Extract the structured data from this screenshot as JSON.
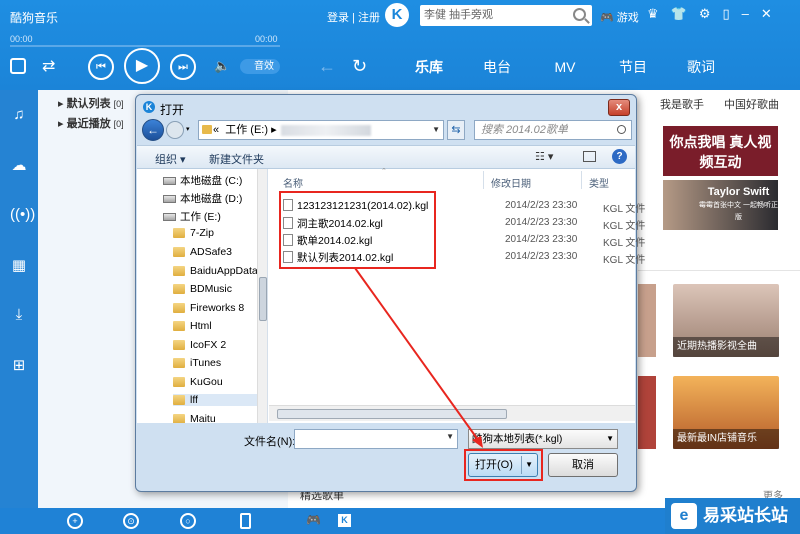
{
  "app": {
    "title": "酷狗音乐",
    "login": "登录 | 注册",
    "logo_letter": "K",
    "search_text": "李健  抽手旁观",
    "game": "游戏",
    "time_start": "00:00",
    "time_end": "00:00",
    "sound_effect": "音效",
    "tabs": [
      "乐库",
      "电台",
      "MV",
      "节目",
      "歌词"
    ],
    "playlists": [
      {
        "label": "默认列表",
        "count": "[0]"
      },
      {
        "label": "最近播放",
        "count": "[0]"
      }
    ],
    "right_links": [
      "我是歌手",
      "中国好歌曲"
    ],
    "banner_1": "你点我唱 真人视频互动",
    "banner_2": "Taylor Swift",
    "banner_2_sub": "霉霉首张中文 一起畅听正版",
    "thumb_1_caption": "近期热播影视全曲",
    "thumb_2_caption": "最新最IN店铺音乐",
    "more": "更多",
    "bottom_text": "精选歌单",
    "watermark": "易采站长站"
  },
  "dialog": {
    "title": "打开",
    "close": "x",
    "address": "工作 (E:)",
    "address_prefix": "«",
    "search_placeholder": "搜索 2014.02歌单",
    "organize": "组织 ▾",
    "new_folder": "新建文件夹",
    "tree": [
      {
        "label": "本地磁盘 (C:)",
        "kind": "drive"
      },
      {
        "label": "本地磁盘 (D:)",
        "kind": "drive"
      },
      {
        "label": "工作 (E:)",
        "kind": "drive"
      },
      {
        "label": "7-Zip",
        "kind": "folder"
      },
      {
        "label": "ADSafe3",
        "kind": "folder"
      },
      {
        "label": "BaiduAppData",
        "kind": "folder"
      },
      {
        "label": "BDMusic",
        "kind": "folder"
      },
      {
        "label": "Fireworks 8",
        "kind": "folder"
      },
      {
        "label": "Html",
        "kind": "folder"
      },
      {
        "label": "IcoFX 2",
        "kind": "folder"
      },
      {
        "label": "iTunes",
        "kind": "folder"
      },
      {
        "label": "KuGou",
        "kind": "folder"
      },
      {
        "label": "lff",
        "kind": "folder"
      },
      {
        "label": "Maitu",
        "kind": "folder"
      }
    ],
    "columns": {
      "name": "名称",
      "modified": "修改日期",
      "type": "类型"
    },
    "files": [
      {
        "name": "123123121231(2014.02).kgl",
        "date": "2014/2/23 23:30",
        "type": "KGL 文件"
      },
      {
        "name": "洞主歌2014.02.kgl",
        "date": "2014/2/23 23:30",
        "type": "KGL 文件"
      },
      {
        "name": "歌单2014.02.kgl",
        "date": "2014/2/23 23:30",
        "type": "KGL 文件"
      },
      {
        "name": "默认列表2014.02.kgl",
        "date": "2014/2/23 23:30",
        "type": "KGL 文件"
      }
    ],
    "filename_label": "文件名(N):",
    "filename_value": "",
    "filetype_value": "酷狗本地列表(*.kgl)",
    "open_button": "打开(O)",
    "cancel_button": "取消"
  },
  "colors": {
    "kugou_blue": "#1b84d8",
    "highlight_red": "#e8261f"
  }
}
